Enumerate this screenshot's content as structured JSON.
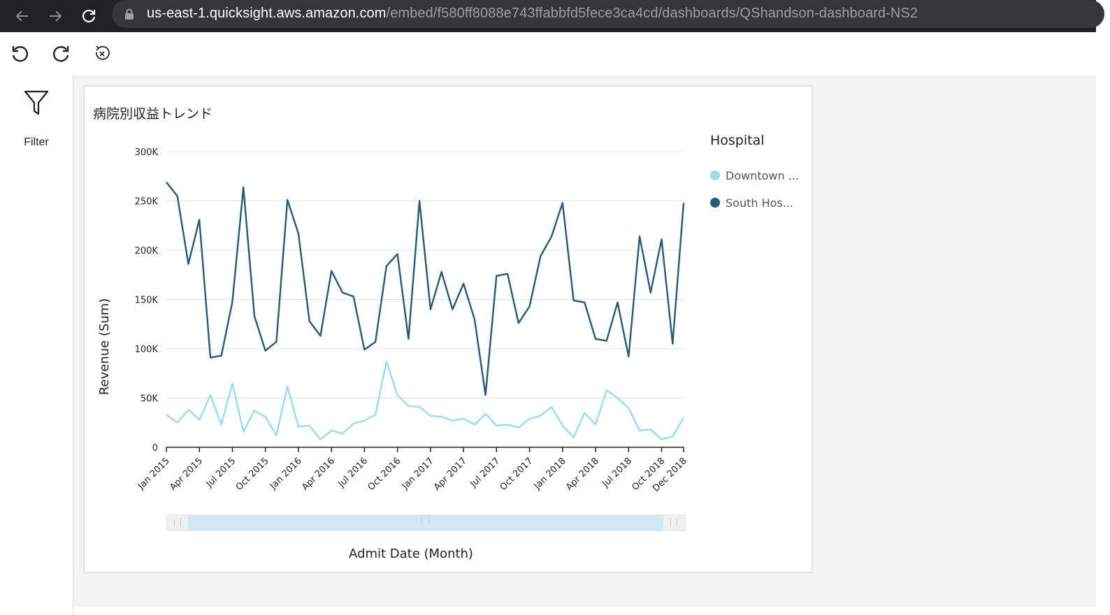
{
  "browser": {
    "url_domain": "us-east-1.quicksight.aws.amazon.com",
    "url_path": "/embed/f580ff8088e743ffabbfd5fece3ca4cd/dashboards/QShandson-dashboard-NS2"
  },
  "left_panel": {
    "filter_label": "Filter"
  },
  "visual": {
    "title": "病院別収益トレンド",
    "legend_title": "Hospital",
    "legend": [
      {
        "label": "Downtown ...",
        "color": "#9adcee"
      },
      {
        "label": "South Hos...",
        "color": "#285a74"
      }
    ]
  },
  "chart_data": {
    "type": "line",
    "xlabel": "Admit Date (Month)",
    "ylabel": "Revenue (Sum)",
    "ylim": [
      0,
      300000
    ],
    "yticks": [
      "0",
      "50K",
      "100K",
      "150K",
      "200K",
      "250K",
      "300K"
    ],
    "xtick_labels": [
      "Jan 2015",
      "Apr 2015",
      "Jul 2015",
      "Oct 2015",
      "Jan 2016",
      "Apr 2016",
      "Jul 2016",
      "Oct 2016",
      "Jan 2017",
      "Apr 2017",
      "Jul 2017",
      "Oct 2017",
      "Jan 2018",
      "Apr 2018",
      "Jul 2018",
      "Oct 2018",
      "Dec 2018"
    ],
    "grid": true,
    "legend_position": "right",
    "x": [
      "2015-01",
      "2015-02",
      "2015-03",
      "2015-04",
      "2015-05",
      "2015-06",
      "2015-07",
      "2015-08",
      "2015-09",
      "2015-10",
      "2015-11",
      "2015-12",
      "2016-01",
      "2016-02",
      "2016-03",
      "2016-04",
      "2016-05",
      "2016-06",
      "2016-07",
      "2016-08",
      "2016-09",
      "2016-10",
      "2016-11",
      "2016-12",
      "2017-01",
      "2017-02",
      "2017-03",
      "2017-04",
      "2017-05",
      "2017-06",
      "2017-07",
      "2017-08",
      "2017-09",
      "2017-10",
      "2017-11",
      "2017-12",
      "2018-01",
      "2018-02",
      "2018-03",
      "2018-04",
      "2018-05",
      "2018-06",
      "2018-07",
      "2018-08",
      "2018-09",
      "2018-10",
      "2018-11",
      "2018-12"
    ],
    "series": [
      {
        "name": "Downtown ...",
        "color": "#9adcee",
        "values": [
          33000,
          25000,
          38000,
          28000,
          53000,
          23000,
          65000,
          16000,
          37000,
          31000,
          12000,
          62000,
          21000,
          22000,
          8000,
          17000,
          14000,
          24000,
          27000,
          33000,
          87000,
          53000,
          42000,
          41000,
          32000,
          31000,
          27000,
          29000,
          23000,
          34000,
          22000,
          23000,
          20000,
          29000,
          32000,
          41000,
          22000,
          10000,
          35000,
          23000,
          58000,
          50000,
          40000,
          17000,
          18000,
          8000,
          11000,
          30000
        ]
      },
      {
        "name": "South Hos...",
        "color": "#285a74",
        "values": [
          269000,
          255000,
          186000,
          231000,
          91000,
          93000,
          148000,
          264000,
          133000,
          98000,
          107000,
          251000,
          217000,
          128000,
          113000,
          179000,
          157000,
          153000,
          99000,
          107000,
          184000,
          196000,
          110000,
          250000,
          140000,
          178000,
          140000,
          166000,
          130000,
          53000,
          174000,
          176000,
          126000,
          143000,
          194000,
          214000,
          248000,
          149000,
          147000,
          110000,
          108000,
          147000,
          92000,
          214000,
          157000,
          211000,
          105000,
          248000
        ]
      }
    ]
  }
}
